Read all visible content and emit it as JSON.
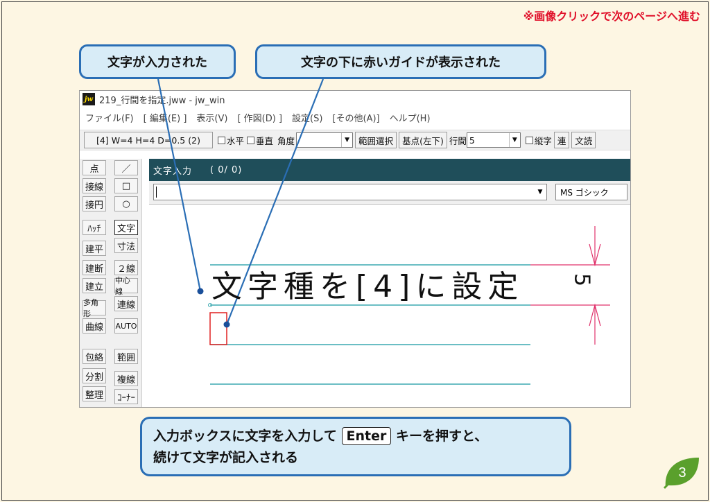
{
  "top_note": "※画像クリックで次のページへ進む",
  "callouts": {
    "left": "文字が入力された",
    "right": "文字の下に赤いガイドが表示された"
  },
  "window": {
    "title": "219_行間を指定.jww - jw_win",
    "icon_text": "jw",
    "menu": [
      "ファイル(F)",
      "[ 編集(E) ]",
      "表示(V)",
      "[ 作図(D) ]",
      "設定(S)",
      "[その他(A)]",
      "ヘルプ(H)"
    ],
    "toolbar": {
      "size_button": "[4]  W=4  H=4  D=0.5 (2)",
      "horizontal": "水平",
      "vertical": "垂直",
      "angle_label": "角度",
      "angle_value": "",
      "range_select": "範囲選択",
      "base_point": "基点(左下)",
      "line_spacing_label": "行間",
      "line_spacing_value": "5",
      "vertical_text": "縦字",
      "continuous": "連",
      "read_text": "文読"
    },
    "left_tools": {
      "col1": [
        "点",
        "接線",
        "接円",
        "ﾊｯﾁ",
        "建平",
        "建断",
        "建立",
        "多角形",
        "曲線",
        "包絡",
        "分割",
        "整理"
      ],
      "col2": [
        "／",
        "□",
        "○",
        "文字",
        "寸法",
        "２線",
        "中心線",
        "連線",
        "AUTO",
        "範囲",
        "複線",
        "ｺｰﾅｰ"
      ]
    },
    "text_panel": {
      "title": "文字入力",
      "count": "( 0/  0)",
      "font": "MS ゴシック"
    },
    "canvas": {
      "entered_text": "文字種を[4]に設定",
      "dimension": "5"
    }
  },
  "bottom_box": {
    "line1_before": "入力ボックスに文字を入力して",
    "key": "Enter",
    "line1_after": "キーを押すと、",
    "line2": "続けて文字が記入される"
  },
  "page_number": "3",
  "colors": {
    "callout_border": "#2a6eb5",
    "callout_fill": "#d8ecf7",
    "guide_red": "#e02020",
    "line_teal": "#3aa8b0",
    "dim_pink": "#e0306a",
    "leaf_green": "#5aa02c"
  }
}
